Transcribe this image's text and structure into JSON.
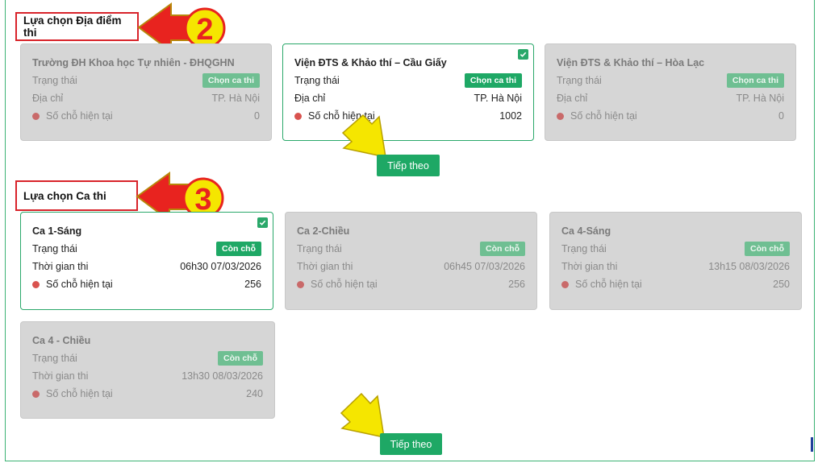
{
  "venue_section": {
    "label": "Lựa chọn Địa điểm thi",
    "step_number": "2",
    "venues": [
      {
        "name": "Trường ĐH Khoa học Tự nhiên - ĐHQGHN",
        "status_label": "Trạng thái",
        "status_badge": "Chọn ca thi",
        "address_label": "Địa chỉ",
        "address": "TP. Hà Nội",
        "seats_label": "Số chỗ hiện tại",
        "seats": "0",
        "selected": false
      },
      {
        "name": "Viện ĐTS & Khảo thí – Cầu Giấy",
        "status_label": "Trạng thái",
        "status_badge": "Chọn ca thi",
        "address_label": "Địa chỉ",
        "address": "TP. Hà Nội",
        "seats_label": "Số chỗ hiện tại",
        "seats": "1002",
        "selected": true
      },
      {
        "name": "Viện ĐTS & Khảo thí – Hòa Lạc",
        "status_label": "Trạng thái",
        "status_badge": "Chọn ca thi",
        "address_label": "Địa chỉ",
        "address": "TP. Hà Nội",
        "seats_label": "Số chỗ hiện tại",
        "seats": "0",
        "selected": false
      }
    ],
    "next_button": "Tiếp theo"
  },
  "session_section": {
    "label": "Lựa chọn Ca thi",
    "step_number": "3",
    "sessions": [
      {
        "name": "Ca 1-Sáng",
        "status_label": "Trạng thái",
        "status_badge": "Còn chỗ",
        "time_label": "Thời gian thi",
        "time": "06h30 07/03/2026",
        "seats_label": "Số chỗ hiện tại",
        "seats": "256",
        "selected": true
      },
      {
        "name": "Ca 2-Chiều",
        "status_label": "Trạng thái",
        "status_badge": "Còn chỗ",
        "time_label": "Thời gian thi",
        "time": "06h45 07/03/2026",
        "seats_label": "Số chỗ hiện tại",
        "seats": "256",
        "selected": false
      },
      {
        "name": "Ca 4-Sáng",
        "status_label": "Trạng thái",
        "status_badge": "Còn chỗ",
        "time_label": "Thời gian thi",
        "time": "13h15 08/03/2026",
        "seats_label": "Số chỗ hiện tại",
        "seats": "250",
        "selected": false
      },
      {
        "name": "Ca 4 - Chiều",
        "status_label": "Trạng thái",
        "status_badge": "Còn chỗ",
        "time_label": "Thời gian thi",
        "time": "13h30 08/03/2026",
        "seats_label": "Số chỗ hiện tại",
        "seats": "240",
        "selected": false
      }
    ],
    "next_button": "Tiếp theo"
  },
  "colors": {
    "accent": "#1ea865",
    "annotation_red": "#e8231f",
    "annotation_yellow": "#f5e600",
    "label_border": "#d8232a"
  },
  "annotations": {
    "arrow_left_icon": "red-arrow-icon",
    "pointer_icon": "yellow-arrow-icon"
  }
}
